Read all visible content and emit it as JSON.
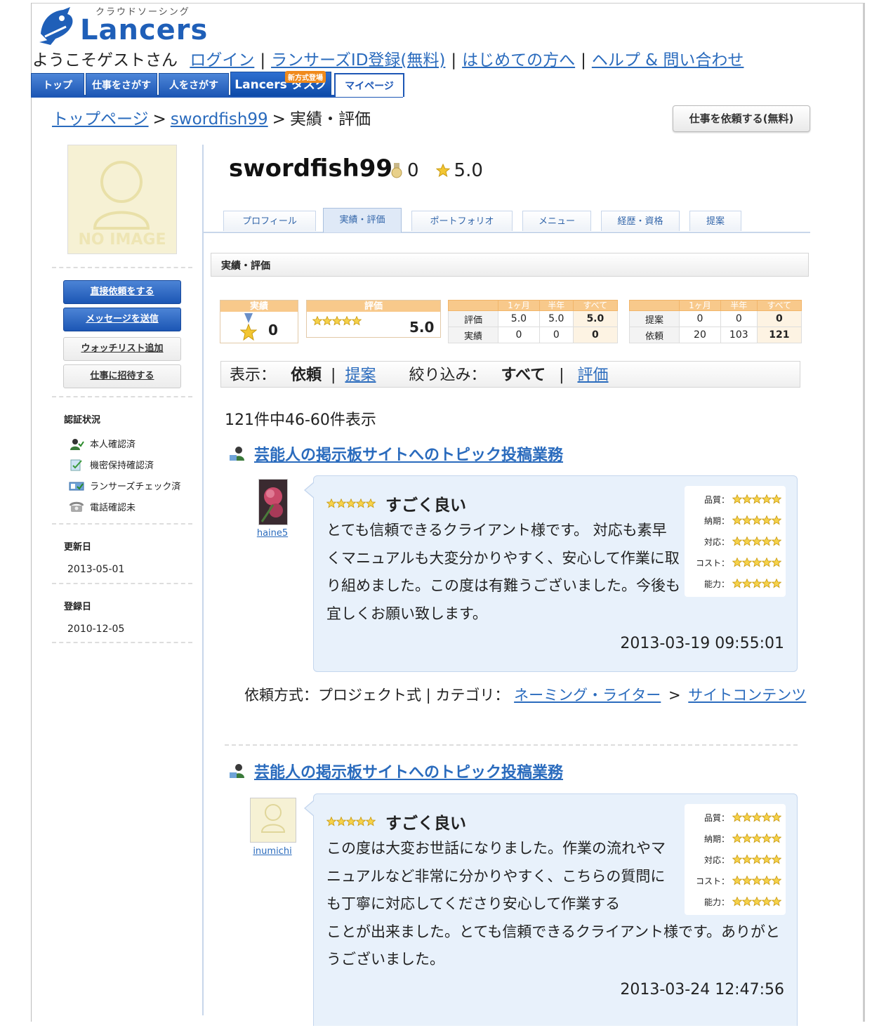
{
  "header": {
    "logo_sub": "クラウドソーシング",
    "logo_word": "Lancers",
    "greeting": "ようこそゲストさん",
    "links": [
      "ログイン",
      "ランサーズID登録(無料)",
      "はじめての方へ",
      "ヘルプ & 問い合わせ"
    ],
    "separator": "|"
  },
  "nav": {
    "tabs": [
      "トップ",
      "仕事をさがす",
      "人をさがす",
      "Lancers タスク",
      "マイページ"
    ],
    "new_badge": "新方式登場"
  },
  "breadcrumb": {
    "home": "トップページ",
    "user": "swordfish99",
    "current": "実績・評価",
    "gt": ">"
  },
  "request_button": "仕事を依頼する(無料)",
  "sidebar": {
    "no_image": "NO IMAGE",
    "buttons": [
      "直接依頼をする",
      "メッセージを送信",
      "ウォッチリスト追加",
      "仕事に招待する"
    ],
    "cert_heading": "認証状況",
    "certs": [
      "本人確認済",
      "機密保持確認済",
      "ランサーズチェック済",
      "電話確認未"
    ],
    "updated_heading": "更新日",
    "updated_date": "2013-05-01",
    "registered_heading": "登録日",
    "registered_date": "2010-12-05"
  },
  "profile": {
    "username": "swordfish99",
    "medal_count": "0",
    "rating": "5.0",
    "tabs": [
      "プロフィール",
      "実績・評価",
      "ポートフォリオ",
      "メニュー",
      "経歴・資格",
      "提案"
    ],
    "active_tab_index": 1
  },
  "section_title": "実績・評価",
  "stats": {
    "achievement_label": "実績",
    "achievement_value": "0",
    "rating_label": "評価",
    "rating_value": "5.0",
    "col_headers": [
      "1ヶ月",
      "半年",
      "すべて"
    ],
    "table1": [
      {
        "label": "評価",
        "values": [
          "5.0",
          "5.0",
          "5.0"
        ]
      },
      {
        "label": "実績",
        "values": [
          "0",
          "0",
          "0"
        ]
      }
    ],
    "table2": [
      {
        "label": "提案",
        "values": [
          "0",
          "0",
          "0"
        ]
      },
      {
        "label": "依頼",
        "values": [
          "20",
          "103",
          "121"
        ]
      }
    ]
  },
  "filter": {
    "display_label": "表示：",
    "display_active": "依頼",
    "display_link": "提案",
    "narrow_label": "絞り込み：",
    "narrow_active": "すべて",
    "narrow_link": "評価",
    "sep": "|"
  },
  "result_count": "121件中46-60件表示",
  "reviews": [
    {
      "job_title": "芸能人の掲示板サイトへのトピック投稿業務",
      "reviewer": "haine5",
      "rating_text": "すごく良い",
      "comment": "とても信頼できるクライアント様です。 対応も素早くマニュアルも大変分かりやすく、安心して作業に取り組めました。この度は有難うございました。今後も宜しくお願い致します。",
      "date": "2013-03-19 09:55:01",
      "scores": [
        "品質：",
        "納期：",
        "対応：",
        "コスト：",
        "能力："
      ],
      "method_label": "依頼方式：プロジェクト式 | カテゴリ：",
      "cat1": "ネーミング・ライター",
      "cat2": "サイトコンテンツ",
      "gt": ">"
    },
    {
      "job_title": "芸能人の掲示板サイトへのトピック投稿業務",
      "reviewer": "inumichi",
      "rating_text": "すごく良い",
      "comment": "この度は大変お世話になりました。作業の流れやマニュアルなど非常に分かりやすく、こちらの質問にも丁寧に対応してくださり安心して作業することが出来ました。とても信頼できるクライアント様です。ありがとうございました。",
      "date": "2013-03-24 12:47:56",
      "scores": [
        "品質：",
        "納期：",
        "対応：",
        "コスト：",
        "能力："
      ]
    }
  ],
  "colors": {
    "brand_blue": "#1f5fb8",
    "link": "#2a6bbd",
    "stat_orange": "#f8c98b",
    "card_bg": "#e8f1fb"
  }
}
